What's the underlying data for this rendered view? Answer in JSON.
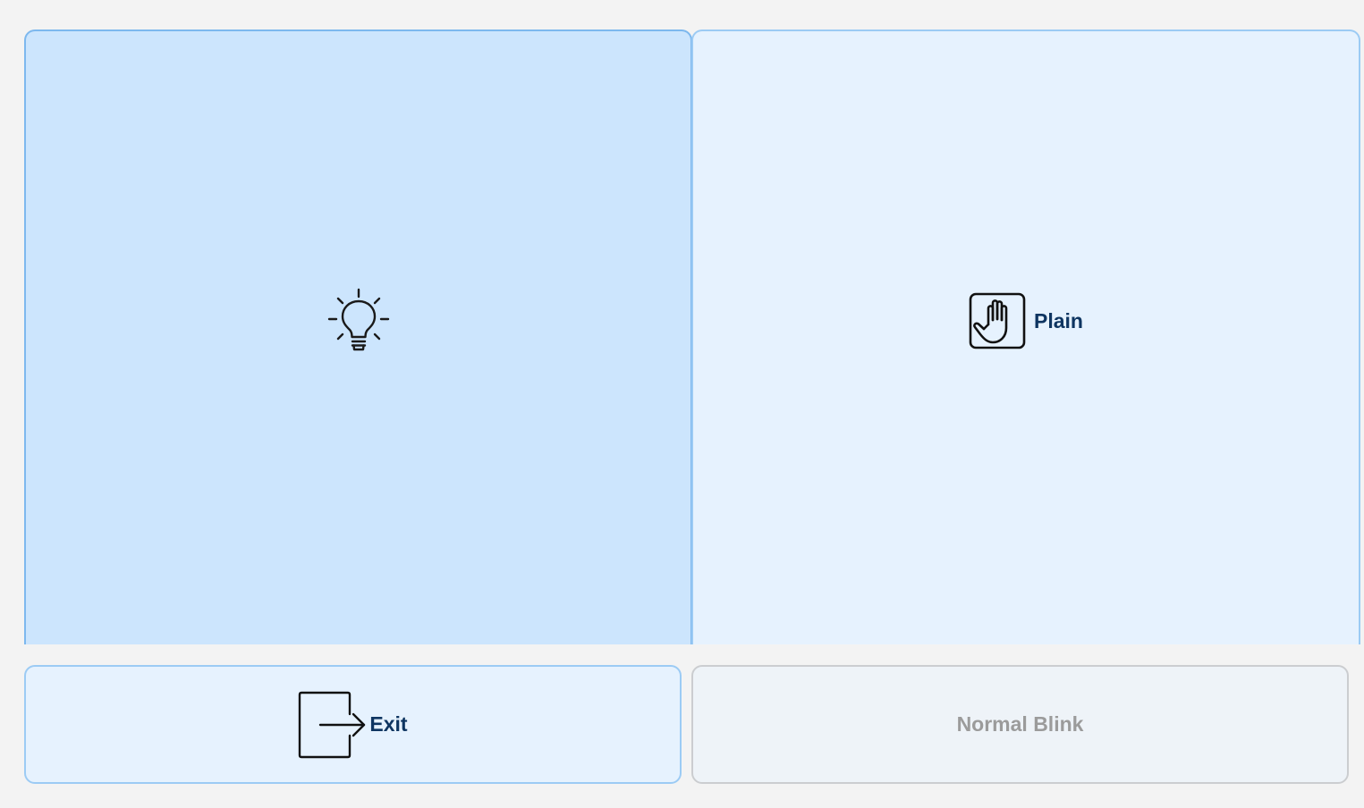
{
  "tiles": {
    "idea": {
      "icon": "lightbulb-icon",
      "label": ""
    },
    "plain": {
      "icon": "hand-palm-icon",
      "label": "Plain"
    },
    "exit": {
      "icon": "exit-arrow-icon",
      "label": "Exit"
    },
    "blink": {
      "label": "Normal Blink",
      "state": "disabled"
    }
  },
  "colors": {
    "selected_tile": "#cce5fd",
    "tile": "#e6f2fe",
    "tile_border": "#9ccbf4",
    "label_text": "#0e3561",
    "disabled_text": "#9b9b9b"
  }
}
